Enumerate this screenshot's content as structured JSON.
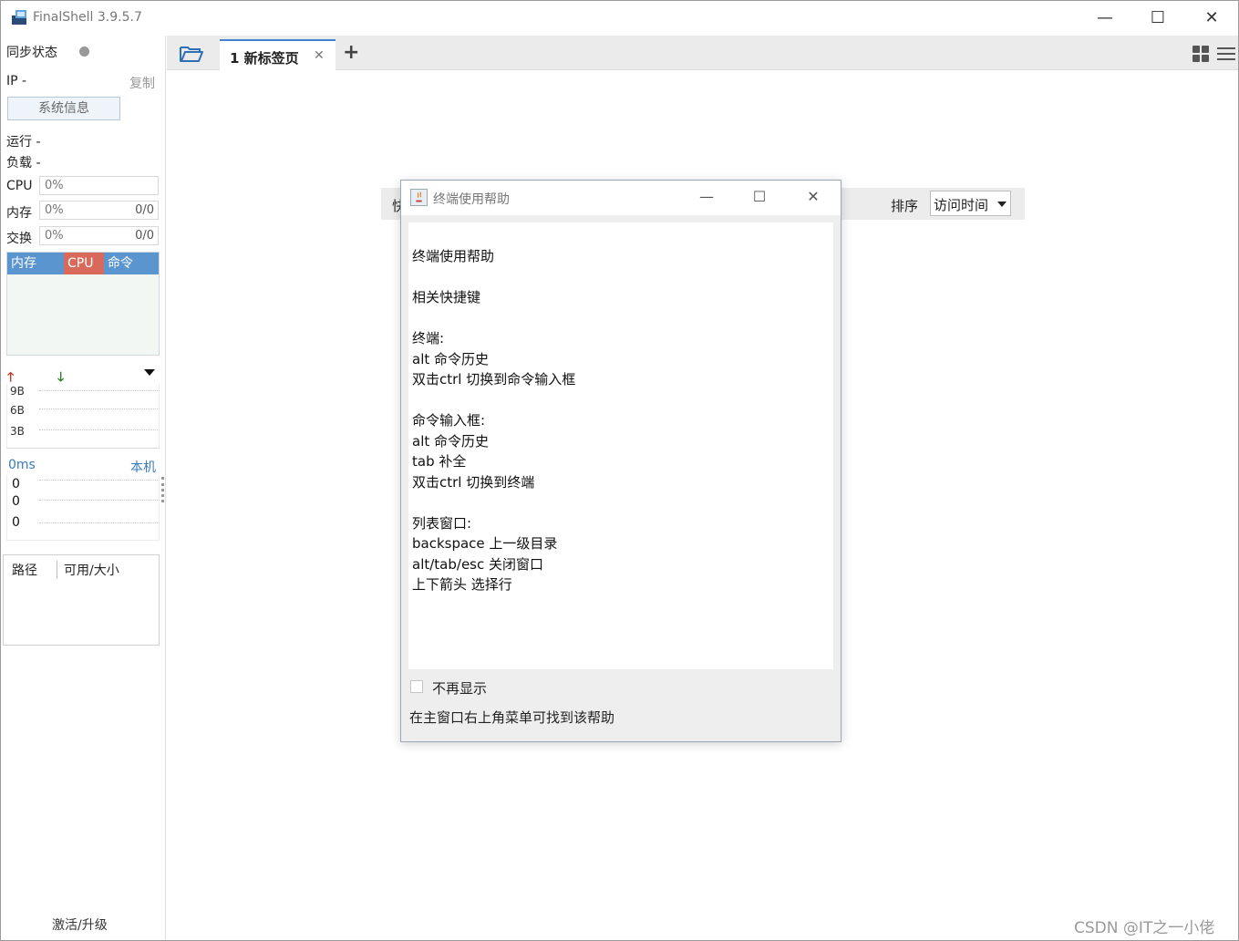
{
  "window": {
    "title": "FinalShell 3.9.5.7",
    "minimize": "—",
    "maximize": "☐",
    "close": "✕"
  },
  "sidebar": {
    "sync_status": "同步状态",
    "ip_label": "IP  -",
    "copy": "复制",
    "sysinfo_button": "系统信息",
    "uptime": "运行 -",
    "load": "负载 -",
    "cpu": {
      "label": "CPU",
      "percent": "0%"
    },
    "memory": {
      "label": "内存",
      "percent": "0%",
      "value": "0/0"
    },
    "swap": {
      "label": "交换",
      "percent": "0%",
      "value": "0/0"
    },
    "process_tabs": [
      "内存",
      "CPU",
      "命令"
    ],
    "net_ticks": [
      "9B",
      "6B",
      "3B"
    ],
    "ping_label": "0ms",
    "ping_local": "本机",
    "ping_values": [
      "0",
      "0",
      "0"
    ],
    "disk_columns": [
      "路径",
      "可用/大小"
    ],
    "activate": "激活/升级"
  },
  "tabs": {
    "items": [
      {
        "label": "1 新标签页",
        "close": "✕"
      }
    ],
    "add": "+"
  },
  "quickbar": {
    "label": "快",
    "sort_label": "排序",
    "sort_value": "访问时间"
  },
  "dialog": {
    "title": "终端使用帮助",
    "minimize": "—",
    "maximize": "☐",
    "close": "✕",
    "lines": [
      "终端使用帮助",
      "",
      "相关快捷键",
      "",
      "终端:",
      "alt 命令历史",
      "双击ctrl 切换到命令输入框",
      "",
      "命令输入框:",
      "alt 命令历史",
      "tab 补全",
      "双击ctrl 切换到终端",
      "",
      "列表窗口:",
      "backspace 上一级目录",
      "alt/tab/esc 关闭窗口",
      "上下箭头 选择行"
    ],
    "dont_show": "不再显示",
    "footer": "在主窗口右上角菜单可找到该帮助"
  },
  "watermark": "CSDN @IT之一小佬",
  "colors": {
    "accent": "#3f86d0",
    "process_header": "#5b95cf",
    "cpu_tab": "#d9695a",
    "ping_text": "#3a7ac0"
  }
}
